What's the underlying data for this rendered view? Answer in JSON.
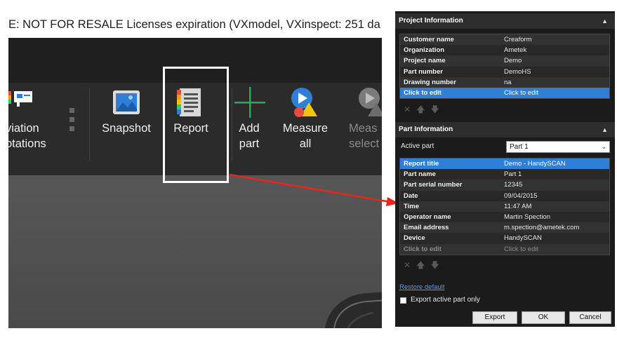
{
  "app": {
    "license_text": "E: NOT FOR RESALE Licenses expiration (VXmodel, VXinspect: 251 da",
    "ribbon": {
      "deviation": {
        "line1": "viation",
        "line2": "otations"
      },
      "snapshot": "Snapshot",
      "report": "Report",
      "add_part": {
        "line1": "Add",
        "line2": "part"
      },
      "measure_all": {
        "line1": "Measure",
        "line2": "all"
      },
      "measure_selected": {
        "line1": "Meas",
        "line2": "select"
      }
    }
  },
  "panel": {
    "project_section": {
      "title": "Project Information",
      "rows": [
        {
          "key": "Customer name",
          "value": "Creaform"
        },
        {
          "key": "Organization",
          "value": "Ametek"
        },
        {
          "key": "Project name",
          "value": "Demo"
        },
        {
          "key": "Part number",
          "value": "DemoHS"
        },
        {
          "key": "Drawing number",
          "value": "na"
        },
        {
          "key": "Click to edit",
          "value": "Click to edit"
        }
      ]
    },
    "part_section": {
      "title": "Part Information",
      "active_part_label": "Active part",
      "active_part_value": "Part 1",
      "rows": [
        {
          "key": "Report title",
          "value": "Demo - HandySCAN"
        },
        {
          "key": "Part name",
          "value": "Part 1"
        },
        {
          "key": "Part serial number",
          "value": "12345"
        },
        {
          "key": "Date",
          "value": "09/04/2015"
        },
        {
          "key": "Time",
          "value": "11:47 AM"
        },
        {
          "key": "Operator name",
          "value": "Martin Spection"
        },
        {
          "key": "Email address",
          "value": "m.spection@ametek.com"
        },
        {
          "key": "Device",
          "value": "HandySCAN"
        },
        {
          "key": "Click to edit",
          "value": "Click to edit"
        }
      ]
    },
    "restore_default": "Restore default",
    "export_active_only": "Export active part only",
    "buttons": {
      "export": "Export",
      "ok": "OK",
      "cancel": "Cancel"
    }
  },
  "colors": {
    "selection": "#2f7fd6",
    "arrow": "#e8251c",
    "add_part_icon": "#1db354",
    "highlight_box": "#ffffff"
  },
  "icons": [
    "deviation-icon",
    "grip-handle-icon",
    "snapshot-icon",
    "report-icon",
    "add-part-icon",
    "measure-all-icon",
    "measure-selected-icon",
    "delete-icon",
    "move-up-icon",
    "move-down-icon",
    "chevron-up-icon",
    "dropdown-chevron-icon"
  ]
}
